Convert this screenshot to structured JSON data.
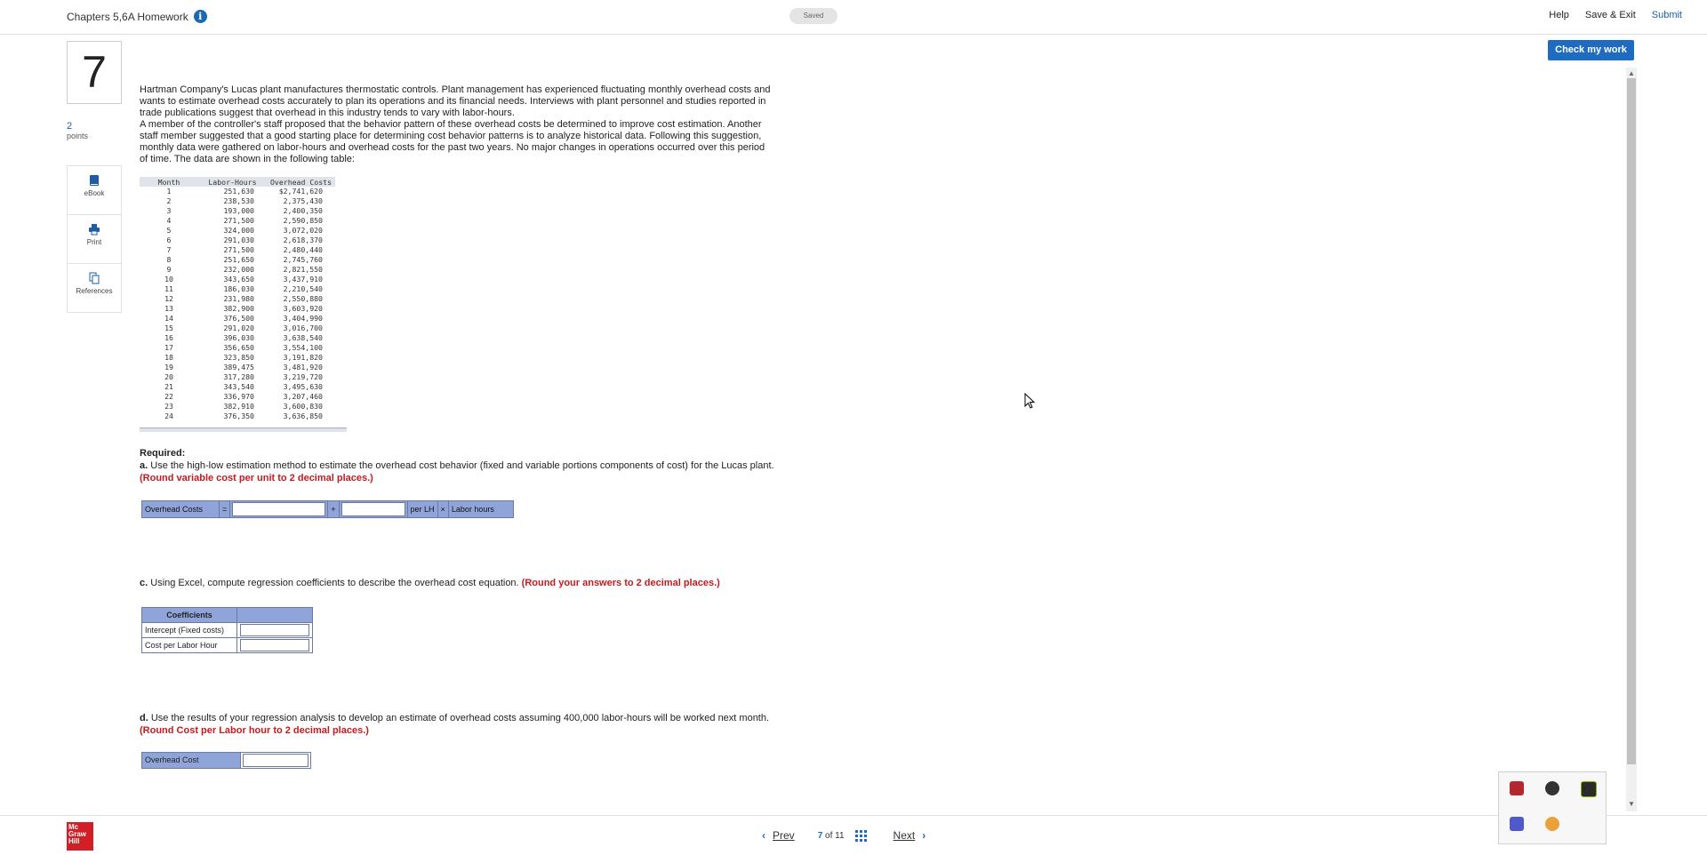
{
  "header": {
    "title": "Chapters 5,6A Homework",
    "saved": "Saved",
    "help": "Help",
    "save_exit": "Save & Exit",
    "submit": "Submit"
  },
  "question": {
    "number": "7",
    "points_value": "2",
    "points_label": "points",
    "check_label": "Check my work"
  },
  "tools": {
    "ebook": "eBook",
    "print": "Print",
    "references": "References"
  },
  "intro": {
    "p1": "Hartman Company's Lucas plant manufactures thermostatic controls. Plant management has experienced fluctuating monthly overhead costs and wants to estimate overhead costs accurately to plan its operations and its financial needs. Interviews with plant personnel and studies reported in trade publications suggest that overhead in this industry tends to vary with labor-hours.",
    "p2": "A member of the controller's staff proposed that the behavior pattern of these overhead costs be determined to improve cost estimation. Another staff member suggested that a good starting place for determining cost behavior patterns is to analyze historical data. Following this suggestion, monthly data were gathered on labor-hours and overhead costs for the past two years. No major changes in operations occurred over this period of time. The data are shown in the following table:"
  },
  "table": {
    "headers": [
      "Month",
      "Labor-Hours",
      "Overhead Costs"
    ],
    "rows": [
      [
        "1",
        "251,630",
        "$2,741,620"
      ],
      [
        "2",
        "238,530",
        "2,375,430"
      ],
      [
        "3",
        "193,000",
        "2,400,350"
      ],
      [
        "4",
        "271,500",
        "2,590,850"
      ],
      [
        "5",
        "324,000",
        "3,072,020"
      ],
      [
        "6",
        "291,030",
        "2,618,370"
      ],
      [
        "7",
        "271,500",
        "2,480,440"
      ],
      [
        "8",
        "251,650",
        "2,745,760"
      ],
      [
        "9",
        "232,000",
        "2,821,550"
      ],
      [
        "10",
        "343,650",
        "3,437,910"
      ],
      [
        "11",
        "186,030",
        "2,210,540"
      ],
      [
        "12",
        "231,980",
        "2,550,880"
      ],
      [
        "13",
        "382,900",
        "3,603,920"
      ],
      [
        "14",
        "376,500",
        "3,404,990"
      ],
      [
        "15",
        "291,020",
        "3,016,700"
      ],
      [
        "16",
        "396,030",
        "3,638,540"
      ],
      [
        "17",
        "356,650",
        "3,554,100"
      ],
      [
        "18",
        "323,850",
        "3,191,820"
      ],
      [
        "19",
        "389,475",
        "3,481,920"
      ],
      [
        "20",
        "317,280",
        "3,219,720"
      ],
      [
        "21",
        "343,540",
        "3,495,630"
      ],
      [
        "22",
        "336,970",
        "3,207,460"
      ],
      [
        "23",
        "382,910",
        "3,600,830"
      ],
      [
        "24",
        "376,350",
        "3,636,850"
      ]
    ]
  },
  "required": {
    "heading": "Required:",
    "a_prefix": "a.",
    "a_text": " Use the high-low estimation method to estimate the overhead cost behavior (fixed and variable portions components of cost) for the Lucas plant. ",
    "a_red": "(Round variable cost per unit to 2 decimal places.)",
    "eq": {
      "label": "Overhead Costs",
      "equals": "=",
      "plus": "+",
      "per_lh": "per LH",
      "times": "×",
      "labor_hours": "Labor hours"
    },
    "c_prefix": "c.",
    "c_text": " Using Excel, compute regression coefficients to describe the overhead cost equation. ",
    "c_red": "(Round your answers to 2 decimal places.)",
    "coef": {
      "header": "Coefficients",
      "intercept": "Intercept (Fixed costs)",
      "cost_per_lh": "Cost per Labor Hour"
    },
    "d_prefix": "d.",
    "d_text": " Use the results of your regression analysis to develop an estimate of overhead costs assuming 400,000 labor-hours will be worked next month. ",
    "d_red": "(Round Cost per Labor hour to 2 decimal places.)",
    "oc_label": "Overhead Cost"
  },
  "footer": {
    "logo_lines": [
      "Mc",
      "Graw",
      "Hill"
    ],
    "prev": "Prev",
    "page_current": "7",
    "page_of": "of",
    "page_total": "11",
    "next": "Next"
  }
}
